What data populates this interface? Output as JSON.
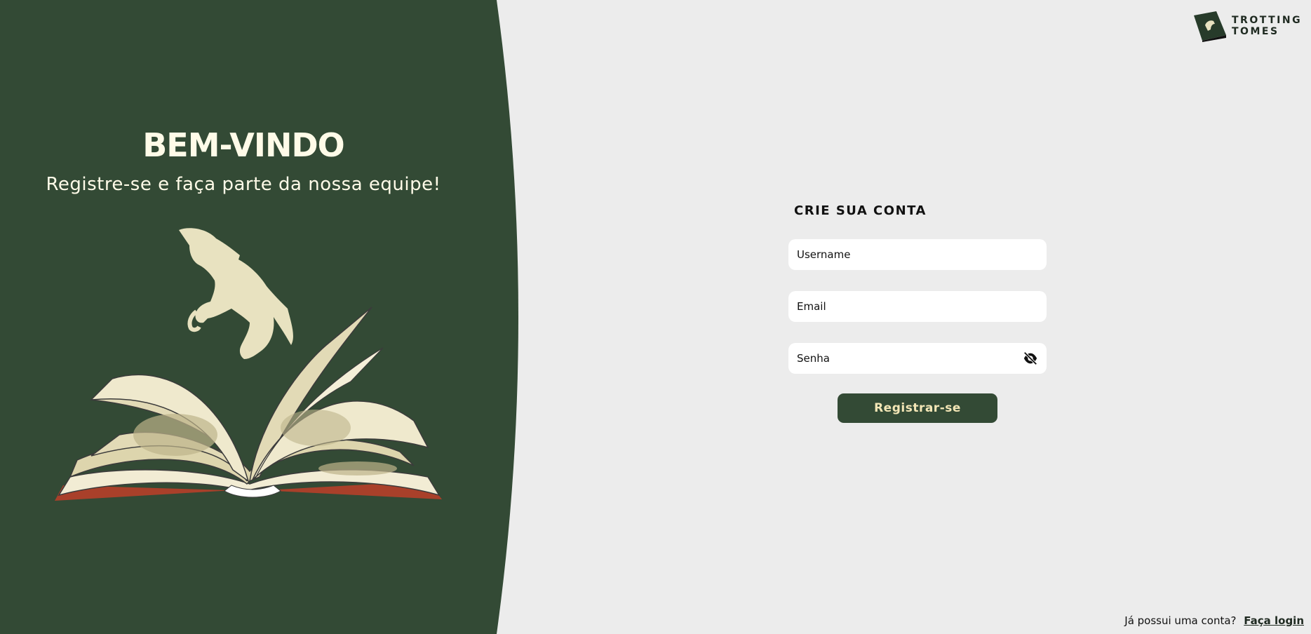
{
  "welcome": {
    "title": "BEM-VINDO",
    "subtitle": "Registre-se e faça parte da nossa equipe!"
  },
  "brand": {
    "line1": "TROTTING",
    "line2": "TOMES"
  },
  "form": {
    "title": "CRIE SUA CONTA",
    "username_placeholder": "Username",
    "email_placeholder": "Email",
    "password_placeholder": "Senha",
    "submit_label": "Registrar-se"
  },
  "footer": {
    "question": "Já possui uma conta?",
    "login_link": "Faça login"
  },
  "icons": {
    "password_toggle": "eye-slash-icon",
    "illustration": "book-horse-illustration",
    "logo": "book-logo-icon"
  },
  "colors": {
    "panel": "#334a35",
    "background": "#ececec",
    "accent_text": "#f3e6b6"
  }
}
